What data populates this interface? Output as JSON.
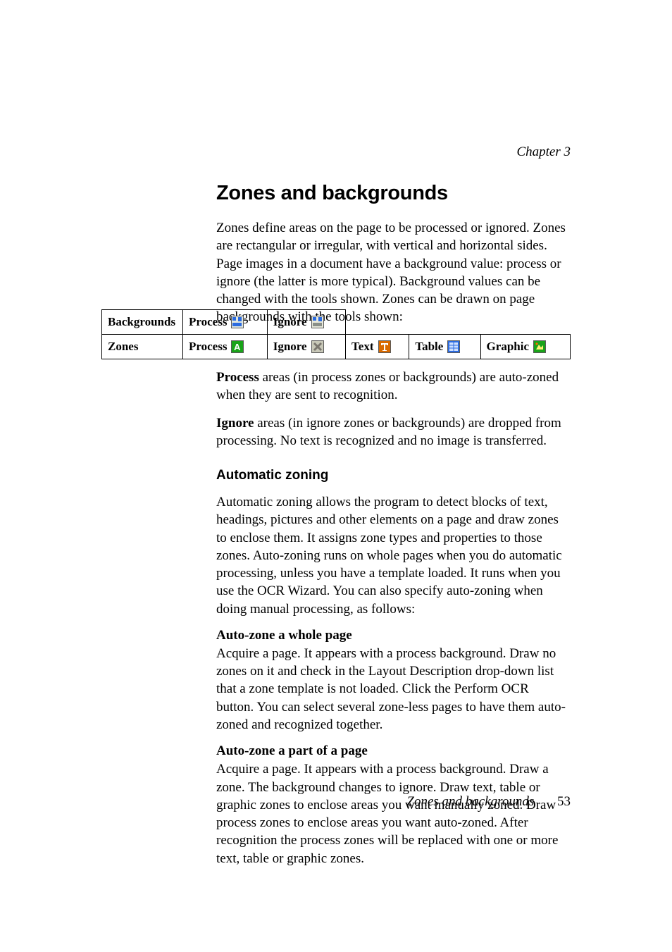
{
  "chapter": "Chapter 3",
  "title": "Zones and backgrounds",
  "intro": "Zones define areas on the page to be processed or ignored. Zones are rectangular or irregular, with vertical and horizontal sides. Page images in a document have a background value: process or ignore (the latter is more typical). Background values can be changed with the tools shown. Zones can be drawn on page backgrounds with the tools shown:",
  "table": {
    "rows": [
      {
        "label": "Backgrounds",
        "cells": [
          "Process",
          "Ignore"
        ]
      },
      {
        "label": "Zones",
        "cells": [
          "Process",
          "Ignore",
          "Text",
          "Table",
          "Graphic"
        ]
      }
    ]
  },
  "process_label": "Process",
  "process_text": " areas (in process zones or backgrounds) are auto-zoned when they are sent to recognition.",
  "ignore_label": "Ignore",
  "ignore_text": " areas (in ignore zones or backgrounds) are dropped from processing. No text is recognized and no image is transferred.",
  "auto_heading": "Automatic zoning",
  "auto_body": "Automatic zoning allows the program to detect blocks of text, headings, pictures and other elements on a page and draw zones to enclose them. It assigns zone types and properties to those zones. Auto-zoning runs on whole pages when you do automatic processing, unless you have a template loaded. It runs when you use the OCR Wizard. You can also specify auto-zoning when doing manual processing, as follows:",
  "az_whole_h": "Auto-zone a whole page",
  "az_whole_b": "Acquire a page. It appears with a process background. Draw no zones on it and check in the Layout Description drop-down list that a zone template is not loaded. Click the Perform OCR button. You can select several zone-less pages to have them auto-zoned and recognized together.",
  "az_part_h": "Auto-zone a part of a page",
  "az_part_b": "Acquire a page. It appears with a process background. Draw a zone. The background changes to ignore. Draw text, table or graphic zones to enclose areas you want manually zoned. Draw process zones to enclose areas you want auto-zoned. After recognition the process zones will be replaced with one or more text, table or graphic zones.",
  "footer_label": "Zones and backgrounds",
  "footer_page": "53"
}
